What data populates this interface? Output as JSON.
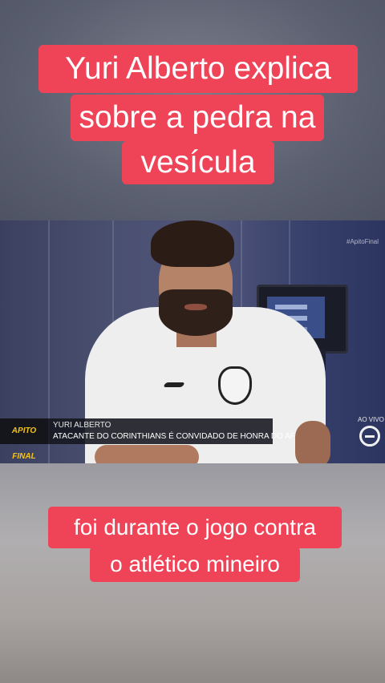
{
  "captions": {
    "top": [
      "Yuri  Alberto  explica",
      "sobre a pedra na",
      "vesícula"
    ],
    "bottom": [
      "foi durante o jogo contra",
      "o atlético mineiro"
    ]
  },
  "video": {
    "watermark": "#ApitoFinal",
    "lower_third": {
      "brand": "APITO FINAL",
      "name": "YURI ALBERTO",
      "description": "ATACANTE DO CORINTHIANS É CONVIDADO DE HONRA DO AF"
    },
    "live_label": "AO VIVO"
  },
  "colors": {
    "caption_background": "#ef4457",
    "caption_text": "#ffffff",
    "brand_yellow": "#f2c21b"
  }
}
